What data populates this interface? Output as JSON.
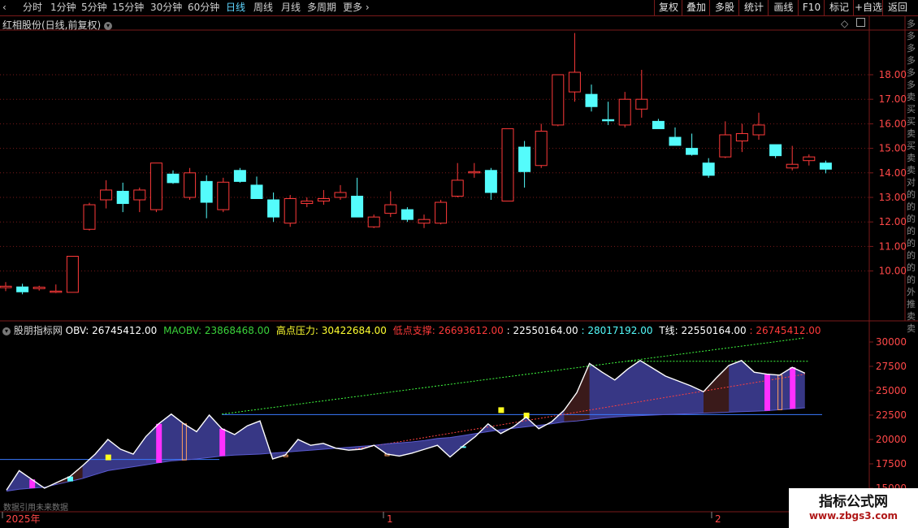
{
  "toolbar": {
    "periods": [
      "分时",
      "1分钟",
      "5分钟",
      "15分钟",
      "30分钟",
      "60分钟",
      "日线",
      "周线",
      "月线",
      "多周期",
      "更多"
    ],
    "active_period": "日线",
    "buttons": [
      "复权",
      "叠加",
      "多股",
      "统计",
      "画线",
      "F10",
      "标记",
      "+自选",
      "返回"
    ]
  },
  "main_panel": {
    "title": "红相股份(日线,前复权)",
    "y_ticks": [
      "18.00",
      "17.00",
      "16.00",
      "15.00",
      "14.00",
      "13.00",
      "12.00",
      "11.00",
      "10.00"
    ],
    "right_sidebar_text": "多多多多多多卖买买卖买卖卖 对的的的的的的的的外推卖卖"
  },
  "indicator_panel": {
    "name": "股朋指标网",
    "obv_label": "OBV:",
    "obv_value": "26745412.00",
    "maobv_label": "MAOBV:",
    "maobv_value": "23868468.00",
    "high_label": "高点压力:",
    "high_value": "30422684.00",
    "low_label": "低点支撑:",
    "low_value": "26693612.00",
    "v5": ": 22550164.00",
    "v6": ": 28017192.00",
    "t_label": "T线:",
    "t_value": "22550164.00",
    "v8": ": 26745412.00",
    "y_ticks": [
      "30000",
      "27500",
      "25000",
      "22500",
      "20000",
      "17500",
      "15000"
    ],
    "bottom_note": "数据引用未来数据"
  },
  "time_axis": {
    "labels": [
      "2025年",
      "1",
      "2"
    ]
  },
  "watermark": {
    "line1": "指标公式网",
    "line2": "www.zbgs3.com"
  },
  "colors": {
    "up": "#ff3a3a",
    "down": "#54fcfc",
    "grid": "#7a1a1a",
    "obv_line": "#ffffff",
    "maobv": "#ff4040",
    "high": "#40ff40",
    "magenta": "#ff30ff",
    "yellow": "#ffff20"
  },
  "chart_data": {
    "type": "candlestick",
    "candles": [
      {
        "o": 9.32,
        "h": 9.55,
        "l": 9.18,
        "c": 9.38
      },
      {
        "o": 9.35,
        "h": 9.48,
        "l": 9.05,
        "c": 9.15
      },
      {
        "o": 9.28,
        "h": 9.4,
        "l": 9.2,
        "c": 9.34
      },
      {
        "o": 9.15,
        "h": 9.45,
        "l": 9.1,
        "c": 9.18
      },
      {
        "o": 9.13,
        "h": 10.6,
        "l": 9.13,
        "c": 10.6
      },
      {
        "o": 11.7,
        "h": 12.78,
        "l": 11.65,
        "c": 12.7
      },
      {
        "o": 12.9,
        "h": 13.7,
        "l": 12.55,
        "c": 13.3
      },
      {
        "o": 13.25,
        "h": 13.6,
        "l": 12.4,
        "c": 12.75
      },
      {
        "o": 12.9,
        "h": 13.4,
        "l": 12.4,
        "c": 13.3
      },
      {
        "o": 12.5,
        "h": 14.2,
        "l": 12.4,
        "c": 14.4
      },
      {
        "o": 13.95,
        "h": 14.1,
        "l": 13.55,
        "c": 13.6
      },
      {
        "o": 13.0,
        "h": 14.2,
        "l": 12.9,
        "c": 14.0
      },
      {
        "o": 13.65,
        "h": 13.9,
        "l": 12.15,
        "c": 12.8
      },
      {
        "o": 12.5,
        "h": 13.8,
        "l": 12.4,
        "c": 13.62
      },
      {
        "o": 14.1,
        "h": 14.2,
        "l": 13.6,
        "c": 13.65
      },
      {
        "o": 13.5,
        "h": 13.85,
        "l": 12.95,
        "c": 12.95
      },
      {
        "o": 12.9,
        "h": 13.2,
        "l": 12.0,
        "c": 12.2
      },
      {
        "o": 11.95,
        "h": 13.1,
        "l": 11.8,
        "c": 12.95
      },
      {
        "o": 12.75,
        "h": 13.0,
        "l": 12.6,
        "c": 12.85
      },
      {
        "o": 12.85,
        "h": 13.3,
        "l": 12.7,
        "c": 12.95
      },
      {
        "o": 13.0,
        "h": 13.5,
        "l": 12.9,
        "c": 13.2
      },
      {
        "o": 13.05,
        "h": 13.8,
        "l": 12.2,
        "c": 12.2
      },
      {
        "o": 11.8,
        "h": 12.3,
        "l": 11.75,
        "c": 12.2
      },
      {
        "o": 12.35,
        "h": 13.25,
        "l": 12.2,
        "c": 12.7
      },
      {
        "o": 12.5,
        "h": 12.6,
        "l": 12.0,
        "c": 12.1
      },
      {
        "o": 11.95,
        "h": 12.3,
        "l": 11.75,
        "c": 12.1
      },
      {
        "o": 11.95,
        "h": 12.9,
        "l": 11.9,
        "c": 12.8
      },
      {
        "o": 13.05,
        "h": 14.4,
        "l": 13.0,
        "c": 13.7
      },
      {
        "o": 14.0,
        "h": 14.4,
        "l": 13.8,
        "c": 14.05
      },
      {
        "o": 14.1,
        "h": 14.2,
        "l": 12.9,
        "c": 13.2
      },
      {
        "o": 12.85,
        "h": 15.8,
        "l": 12.85,
        "c": 15.8
      },
      {
        "o": 15.05,
        "h": 15.3,
        "l": 13.4,
        "c": 14.05
      },
      {
        "o": 14.3,
        "h": 16.0,
        "l": 14.2,
        "c": 15.7
      },
      {
        "o": 15.95,
        "h": 18.0,
        "l": 15.9,
        "c": 18.0
      },
      {
        "o": 17.3,
        "h": 19.7,
        "l": 16.9,
        "c": 18.1
      },
      {
        "o": 17.2,
        "h": 17.6,
        "l": 16.5,
        "c": 16.7
      },
      {
        "o": 16.17,
        "h": 16.9,
        "l": 15.95,
        "c": 16.13
      },
      {
        "o": 15.95,
        "h": 17.3,
        "l": 15.85,
        "c": 17.0
      },
      {
        "o": 16.6,
        "h": 18.2,
        "l": 16.25,
        "c": 17.0
      },
      {
        "o": 16.1,
        "h": 16.2,
        "l": 15.8,
        "c": 15.8
      },
      {
        "o": 15.45,
        "h": 15.85,
        "l": 15.15,
        "c": 15.12
      },
      {
        "o": 15.0,
        "h": 15.6,
        "l": 14.7,
        "c": 14.75
      },
      {
        "o": 14.4,
        "h": 14.6,
        "l": 13.8,
        "c": 13.9
      },
      {
        "o": 14.65,
        "h": 16.1,
        "l": 14.6,
        "c": 15.55
      },
      {
        "o": 15.3,
        "h": 16.0,
        "l": 14.85,
        "c": 15.6
      },
      {
        "o": 15.55,
        "h": 16.45,
        "l": 15.35,
        "c": 15.95
      },
      {
        "o": 15.15,
        "h": 15.15,
        "l": 14.6,
        "c": 14.7
      },
      {
        "o": 14.2,
        "h": 15.1,
        "l": 14.1,
        "c": 14.35
      },
      {
        "o": 14.5,
        "h": 14.75,
        "l": 14.3,
        "c": 14.65
      },
      {
        "o": 14.4,
        "h": 14.5,
        "l": 13.98,
        "c": 14.15
      }
    ],
    "indicator": {
      "name": "OBV",
      "obv": [
        14800,
        16800,
        15900,
        15000,
        15600,
        16200,
        17300,
        18500,
        20000,
        19000,
        18500,
        20300,
        21600,
        22600,
        21600,
        20800,
        22500,
        21100,
        20500,
        21400,
        21900,
        18000,
        18400,
        20000,
        19400,
        19600,
        19100,
        18900,
        19000,
        19400,
        18500,
        18300,
        18600,
        19000,
        19400,
        18200,
        19300,
        20300,
        21600,
        20600,
        21300,
        22300,
        21100,
        21800,
        23000,
        24800,
        27800,
        26900,
        26100,
        27200,
        28100,
        27300,
        26500,
        26000,
        25500,
        24900,
        26300,
        27600,
        28100,
        26900,
        26700,
        26600,
        27400,
        26800
      ],
      "maobv": [
        14700,
        14900,
        15000,
        15100,
        15400,
        15700,
        16000,
        16400,
        16800,
        17000,
        17200,
        17400,
        17600,
        17800,
        17900,
        18000,
        18150,
        18300,
        18400,
        18450,
        18500,
        18600,
        18700,
        18800,
        18900,
        19000,
        19100,
        19200,
        19300,
        19400,
        19550,
        19650,
        19750,
        19900,
        20100,
        20200,
        20400,
        20600,
        20800,
        21000,
        21150,
        21300,
        21450,
        21600,
        21800,
        21900,
        22050,
        22200,
        22300,
        22400,
        22450,
        22500,
        22550,
        22600,
        22650,
        22700,
        22750,
        22800,
        22850,
        22900,
        22950,
        23050,
        23150,
        23250
      ],
      "high_line": {
        "from": {
          "i": 17,
          "v": 22600
        },
        "to": {
          "i": 63,
          "v": 30422.684
        }
      },
      "resistance_level": 22550.164,
      "low_line": {
        "from": {
          "i": 27,
          "v": 18900
        },
        "to": {
          "i": 63,
          "v": 26693.612
        }
      },
      "upper_level": 28017.192,
      "left_support": 17950,
      "magenta_bars": [
        2,
        12,
        17,
        60,
        62
      ],
      "cyan_bars": [
        5,
        36
      ]
    }
  }
}
